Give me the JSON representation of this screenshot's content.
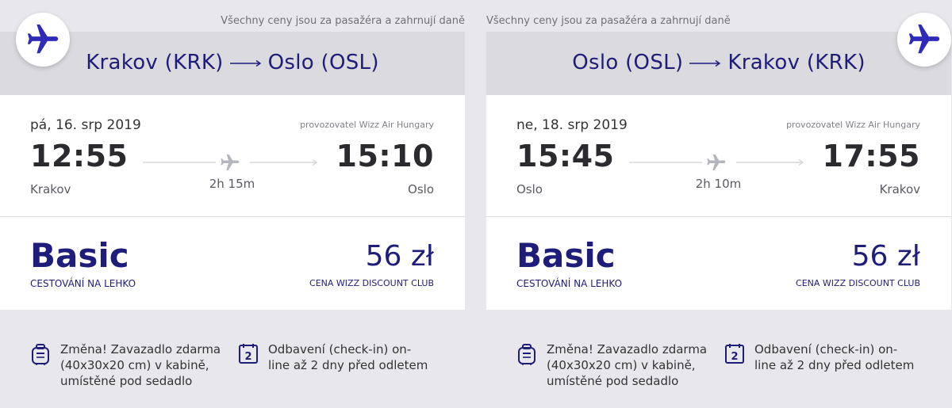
{
  "colors": {
    "brand": "#1f1d7a",
    "plane_badge_icon": "#2f2bb8",
    "muted_plane": "#b5b5bd",
    "panel_bg": "#dadadf"
  },
  "outbound": {
    "price_note": "Všechny ceny jsou za pasažéra a zahrnují daně",
    "route": {
      "origin": "Krakov (KRK)",
      "destination": "Oslo (OSL)"
    },
    "date": "pá, 16. srp 2019",
    "operator": "provozovatel Wizz Air Hungary",
    "departure_time": "12:55",
    "arrival_time": "15:10",
    "departure_city": "Krakov",
    "arrival_city": "Oslo",
    "duration": "2h 15m",
    "fare_name": "Basic",
    "fare_subtitle": "CESTOVÁNÍ NA LEHKO",
    "price": "56 zł",
    "price_subtitle": "CENA WIZZ DISCOUNT CLUB",
    "features": [
      {
        "icon": "bag-icon",
        "lines": [
          "Změna! Zavazadlo zdarma",
          "(40x30x20 cm) v kabině,",
          "umístěné pod sedadlo"
        ]
      },
      {
        "icon": "calendar-icon",
        "badge": "2",
        "lines": [
          "Odbavení (check-in) on-",
          "line až 2 dny před odletem"
        ]
      }
    ]
  },
  "return": {
    "price_note": "Všechny ceny jsou za pasažéra a zahrnují daně",
    "route": {
      "origin": "Oslo (OSL)",
      "destination": "Krakov (KRK)"
    },
    "date": "ne, 18. srp 2019",
    "operator": "provozovatel Wizz Air Hungary",
    "departure_time": "15:45",
    "arrival_time": "17:55",
    "departure_city": "Oslo",
    "arrival_city": "Krakov",
    "duration": "2h 10m",
    "fare_name": "Basic",
    "fare_subtitle": "CESTOVÁNÍ NA LEHKO",
    "price": "56 zł",
    "price_subtitle": "CENA WIZZ DISCOUNT CLUB",
    "features": [
      {
        "icon": "bag-icon",
        "lines": [
          "Změna! Zavazadlo zdarma",
          "(40x30x20 cm) v kabině,",
          "umístěné pod sedadlo"
        ]
      },
      {
        "icon": "calendar-icon",
        "badge": "2",
        "lines": [
          "Odbavení (check-in) on-",
          "line až 2 dny před odletem"
        ]
      }
    ]
  }
}
